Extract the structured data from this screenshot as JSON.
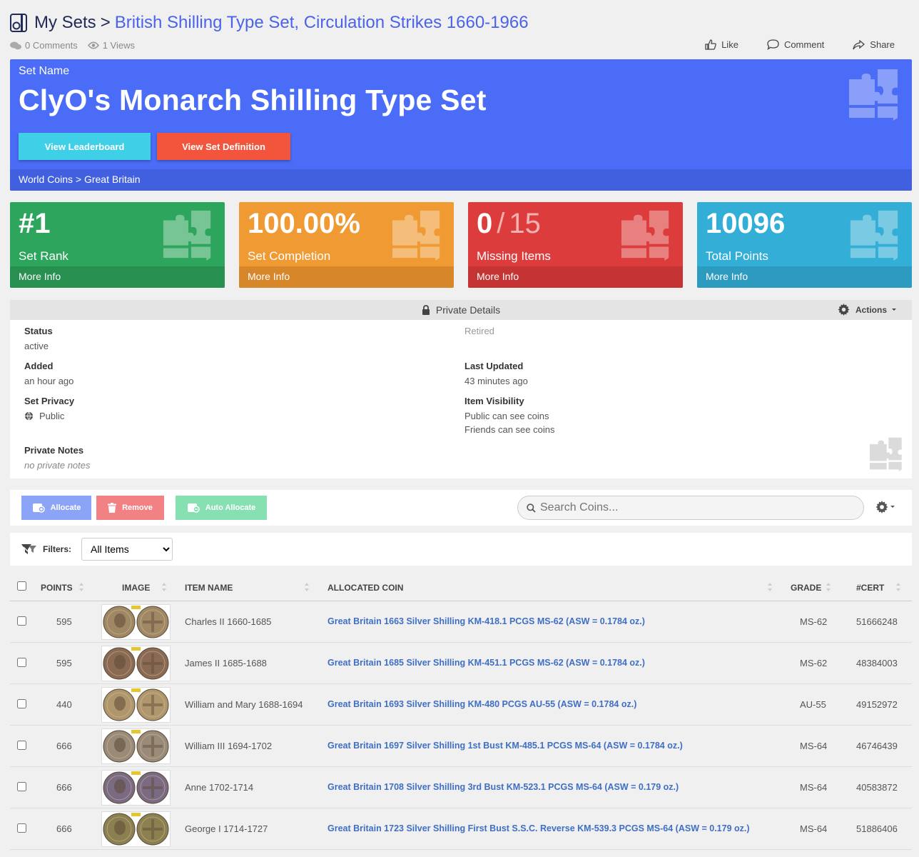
{
  "header": {
    "root": "My Sets",
    "separator": ">",
    "leaf": "British Shilling Type Set, Circulation Strikes 1660-1966",
    "comments": "0 Comments",
    "views": "1 Views",
    "like": "Like",
    "comment": "Comment",
    "share": "Share"
  },
  "hero": {
    "label": "Set Name",
    "title": "ClyO's Monarch Shilling Type Set",
    "leaderboard_btn": "View Leaderboard",
    "definition_btn": "View Set Definition",
    "breadcrumb": "World Coins > Great Britain"
  },
  "stats": {
    "rank": {
      "value": "#1",
      "label": "Set Rank",
      "more": "More Info",
      "color": "#2ea55d"
    },
    "completion": {
      "value": "100.00%",
      "label": "Set Completion",
      "more": "More Info",
      "color": "#ef9a32"
    },
    "missing": {
      "value": "0",
      "slash": "/",
      "total": "15",
      "label": "Missing Items",
      "more": "More Info",
      "color": "#dd3c3c"
    },
    "points": {
      "value": "10096",
      "label": "Total Points",
      "more": "More Info",
      "color": "#33aed6"
    }
  },
  "private": {
    "heading": "Private Details",
    "actions": "Actions",
    "status_k": "Status",
    "status_v": "active",
    "retired_k": "Retired",
    "added_k": "Added",
    "added_v": "an hour ago",
    "updated_k": "Last Updated",
    "updated_v": "43 minutes ago",
    "privacy_k": "Set Privacy",
    "privacy_v": "Public",
    "visibility_k": "Item Visibility",
    "visibility_v1": "Public can see coins",
    "visibility_v2": "Friends can see coins",
    "notes_k": "Private Notes",
    "notes_v": "no private notes"
  },
  "toolbar": {
    "allocate": "Allocate",
    "remove": "Remove",
    "auto_allocate": "Auto Allocate",
    "search_placeholder": "Search Coins..."
  },
  "filters": {
    "label": "Filters:",
    "selected": "All Items"
  },
  "table": {
    "headers": {
      "points": "POINTS",
      "image": "IMAGE",
      "item": "ITEM NAME",
      "coin": "ALLOCATED COIN",
      "grade": "GRADE",
      "cert": "#CERT"
    },
    "rows": [
      {
        "points": "595",
        "item": "Charles II 1660-1685",
        "coin": "Great Britain 1663 Silver Shilling KM-418.1 PCGS MS-62 (ASW = 0.1784 oz.)",
        "grade": "MS-62",
        "cert": "51666248",
        "tone": "#a08864"
      },
      {
        "points": "595",
        "item": "James II 1685-1688",
        "coin": "Great Britain 1685 Silver Shilling KM-451.1 PCGS MS-62 (ASW = 0.1784 oz.)",
        "grade": "MS-62",
        "cert": "48384003",
        "tone": "#8a6a52"
      },
      {
        "points": "440",
        "item": "William and Mary 1688-1694",
        "coin": "Great Britain 1693 Silver Shilling KM-480 PCGS AU-55 (ASW = 0.1784 oz.)",
        "grade": "AU-55",
        "cert": "49152972",
        "tone": "#b0966c"
      },
      {
        "points": "666",
        "item": "William III 1694-1702",
        "coin": "Great Britain 1697 Silver Shilling 1st Bust KM-485.1 PCGS MS-64 (ASW = 0.1784 oz.)",
        "grade": "MS-64",
        "cert": "46746439",
        "tone": "#9a8a78"
      },
      {
        "points": "666",
        "item": "Anne 1702-1714",
        "coin": "Great Britain 1708 Silver Shilling 3rd Bust KM-523.1 PCGS MS-64 (ASW = 0.179 oz.)",
        "grade": "MS-64",
        "cert": "40583872",
        "tone": "#7a6a82"
      },
      {
        "points": "666",
        "item": "George I 1714-1727",
        "coin": "Great Britain 1723 Silver Shilling First Bust S.S.C. Reverse KM-539.3 PCGS MS-64 (ASW = 0.179 oz.)",
        "grade": "MS-64",
        "cert": "51886406",
        "tone": "#8c8050"
      }
    ]
  }
}
